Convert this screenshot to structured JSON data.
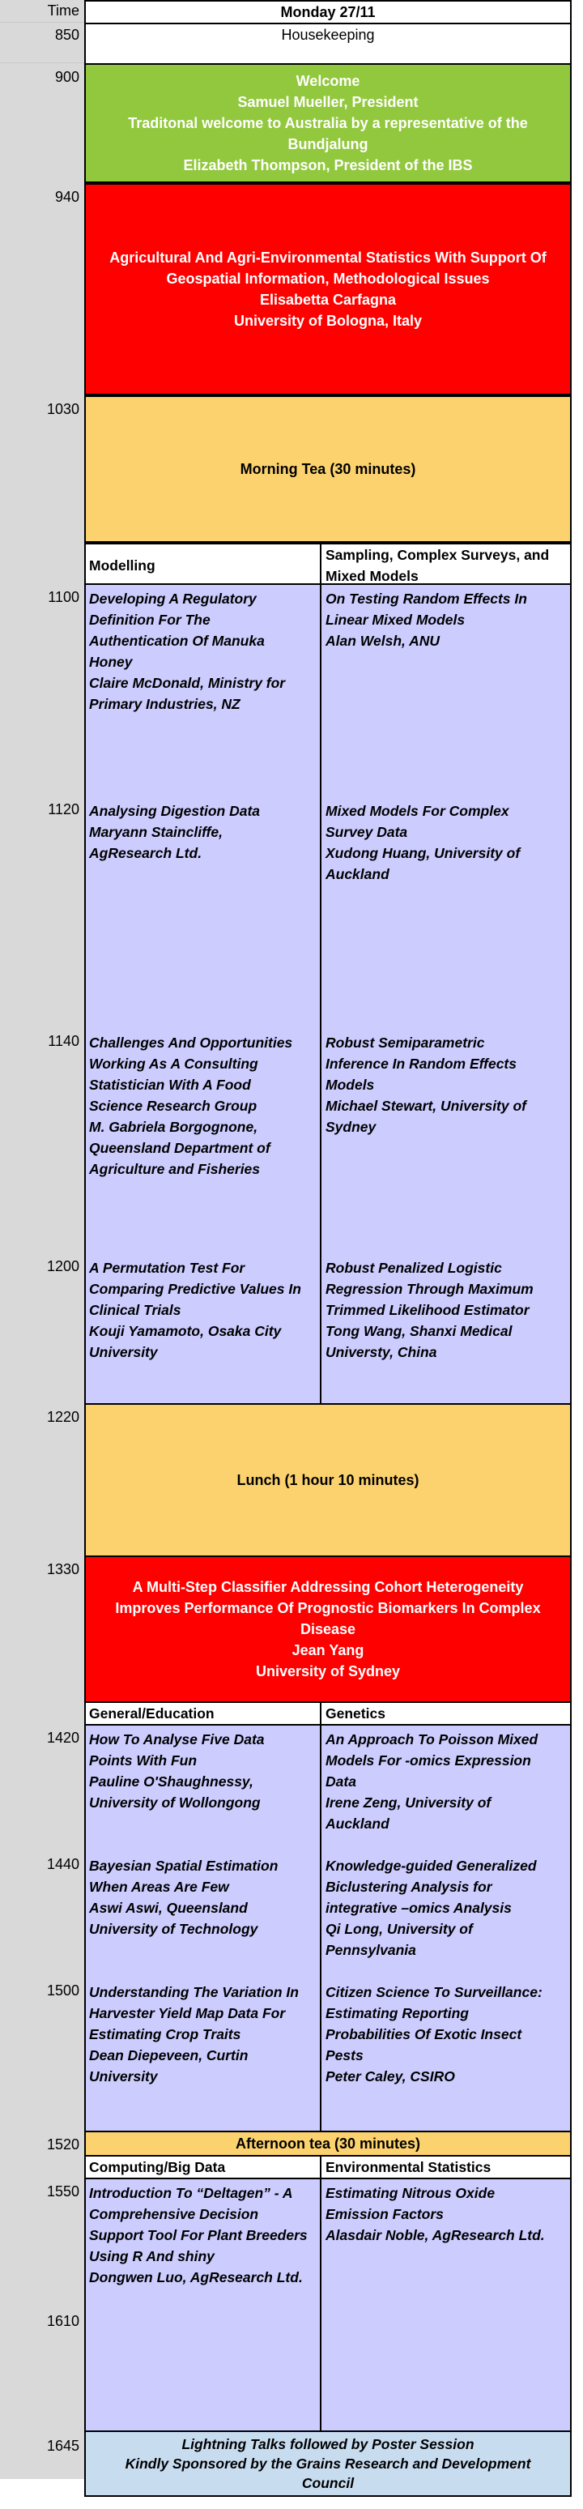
{
  "header": {
    "time_label": "Time",
    "day": "Monday 27/11"
  },
  "housekeeping": {
    "time": "850",
    "label": "Housekeeping"
  },
  "welcome": {
    "time": "900",
    "lines": [
      "Welcome",
      "Samuel Mueller, President",
      "Traditonal welcome to Australia by a representative of the Bundjalung",
      "Elizabeth Thompson, President of the IBS"
    ]
  },
  "keynote1": {
    "time": "940",
    "lines": [
      "Agricultural And Agri-Environmental Statistics With Support Of",
      "Geospatial Information, Methodological Issues",
      "Elisabetta Carfagna",
      "University of Bologna, Italy"
    ]
  },
  "morning_tea": {
    "time": "1030",
    "label": "Morning Tea (30 minutes)"
  },
  "session1": {
    "left_title": "Modelling",
    "right_title": "Sampling, Complex Surveys, and Mixed Models",
    "slots": [
      {
        "time": "1100",
        "left": [
          "Developing A Regulatory",
          "Definition For The",
          "Authentication Of Manuka",
          "Honey",
          "Claire McDonald, Ministry for",
          "Primary Industries, NZ"
        ],
        "right": [
          "On Testing Random Effects In",
          "Linear Mixed Models",
          "Alan Welsh, ANU"
        ]
      },
      {
        "time": "1120",
        "left": [
          "Analysing Digestion Data",
          "Maryann Staincliffe,",
          "AgResearch Ltd."
        ],
        "right": [
          "Mixed Models For Complex",
          "Survey Data",
          "Xudong Huang, University of",
          "Auckland"
        ]
      },
      {
        "time": "1140",
        "left": [
          "Challenges And Opportunities",
          "Working As A Consulting",
          "Statistician With A Food",
          "Science Research Group",
          "M. Gabriela Borgognone,",
          "Queensland Department of",
          "Agriculture and Fisheries"
        ],
        "right": [
          "Robust Semiparametric",
          "Inference In Random Effects",
          "Models",
          "Michael Stewart, University of",
          "Sydney"
        ]
      },
      {
        "time": "1200",
        "left": [
          "A Permutation Test For",
          "Comparing Predictive Values In",
          "Clinical Trials",
          "Kouji Yamamoto, Osaka City",
          "University"
        ],
        "right": [
          "Robust Penalized Logistic",
          "Regression Through Maximum",
          "Trimmed Likelihood Estimator",
          "Tong Wang, Shanxi Medical",
          "Universty, China"
        ]
      }
    ]
  },
  "lunch": {
    "time": "1220",
    "label": "Lunch (1 hour 10 minutes)"
  },
  "keynote2": {
    "time": "1330",
    "lines": [
      "A Multi-Step Classifier Addressing Cohort Heterogeneity",
      "Improves Performance Of Prognostic Biomarkers In Complex",
      "Disease",
      "Jean Yang",
      "University of Sydney"
    ]
  },
  "session2": {
    "left_title": "General/Education",
    "right_title": "Genetics",
    "slots": [
      {
        "time": "1420",
        "left": [
          "How To Analyse Five Data",
          "Points With Fun",
          "Pauline O'Shaughnessy,",
          "University of Wollongong"
        ],
        "right": [
          "An Approach To Poisson Mixed",
          "Models For -omics Expression",
          "Data",
          "Irene Zeng, University of",
          "Auckland"
        ]
      },
      {
        "time": "1440",
        "left": [
          "Bayesian Spatial Estimation",
          "When Areas Are Few",
          "Aswi Aswi, Queensland",
          "University of Technology"
        ],
        "right": [
          "Knowledge-guided Generalized",
          "Biclustering Analysis for",
          "integrative –omics Analysis",
          "Qi Long, University of",
          "Pennsylvania"
        ]
      },
      {
        "time": "1500",
        "left": [
          "Understanding The Variation In",
          "Harvester Yield Map Data For",
          "Estimating Crop Traits",
          "Dean Diepeveen, Curtin",
          "University"
        ],
        "right": [
          "Citizen Science To Surveillance:",
          "Estimating Reporting",
          "Probabilities Of Exotic Insect",
          "Pests",
          "Peter Caley, CSIRO"
        ]
      }
    ]
  },
  "afternoon_tea": {
    "time": "1520",
    "label": "Afternoon tea (30 minutes)"
  },
  "session3": {
    "left_title": "Computing/Big Data",
    "right_title": "Environmental Statistics",
    "slots": [
      {
        "time": "1550",
        "left": [
          "Introduction To “Deltagen” - A",
          "Comprehensive Decision",
          "Support Tool For Plant Breeders",
          "Using R And shiny",
          "Dongwen Luo, AgResearch Ltd."
        ],
        "right": [
          "Estimating Nitrous Oxide",
          "Emission Factors",
          "Alasdair Noble, AgResearch Ltd."
        ]
      }
    ],
    "extra_time": "1610"
  },
  "lightning": {
    "time": "1645",
    "lines": [
      "Lightning Talks followed by Poster Session",
      "Kindly Sponsored by the Grains Research and Development",
      "Council"
    ]
  },
  "colors": {
    "time_column": "#d9d9d9",
    "welcome": "#92c83e",
    "keynote": "#ff0000",
    "tea": "#fcd26f",
    "session": "#ccccff",
    "lightning": "#c8dcf0"
  }
}
